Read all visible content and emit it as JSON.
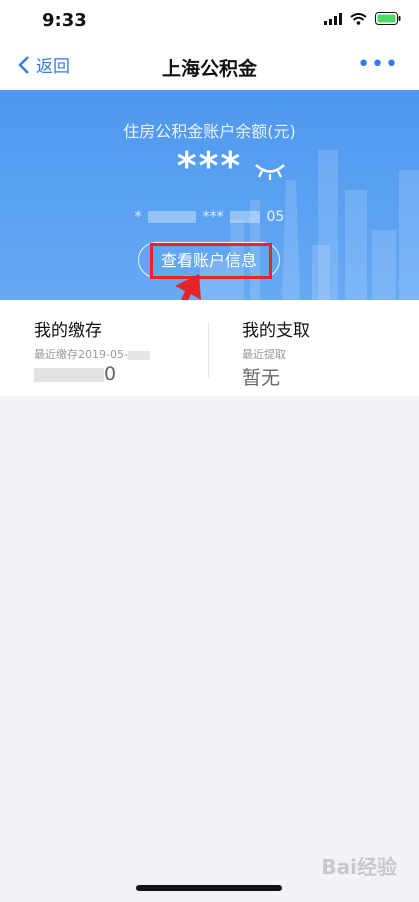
{
  "status": {
    "time": "9:33"
  },
  "nav": {
    "back_label": "返回",
    "title": "上海公积金",
    "more_label": "•••"
  },
  "hero": {
    "balance_label": "住房公积金账户余额(元)",
    "balance": "***",
    "account_prefix": "*",
    "account_middle": "***",
    "account_suffix": "05",
    "view_button": "查看账户信息"
  },
  "cards": {
    "deposit": {
      "title": "我的缴存",
      "sub": "最近缴存2019-05-",
      "value_tail": "0"
    },
    "withdraw": {
      "title": "我的支取",
      "sub": "最近提取",
      "value": "暂无"
    }
  },
  "watermark": "Bai经验",
  "colors": {
    "accent": "#2f7be7",
    "hero_top": "#4d97ef",
    "annotation": "#e8232a"
  }
}
